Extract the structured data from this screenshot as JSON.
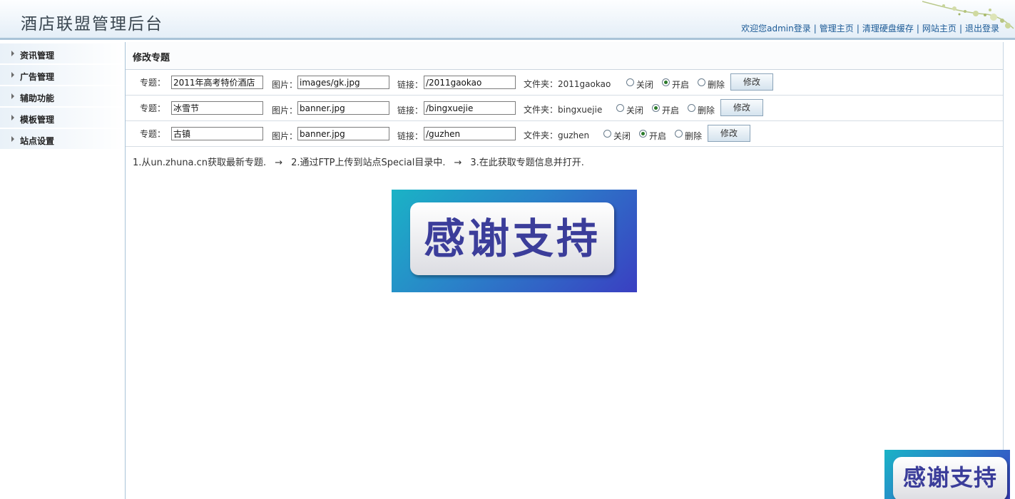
{
  "header": {
    "title": "酒店联盟管理后台",
    "welcome": "欢迎您admin登录",
    "links": [
      "管理主页",
      "清理硬盘缓存",
      "网站主页",
      "退出登录"
    ],
    "separator": "|"
  },
  "sidebar": {
    "items": [
      {
        "label": "资讯管理"
      },
      {
        "label": "广告管理"
      },
      {
        "label": "辅助功能"
      },
      {
        "label": "模板管理"
      },
      {
        "label": "站点设置"
      }
    ]
  },
  "main": {
    "title": "修改专题",
    "labels": {
      "topic": "专题：",
      "image": "图片：",
      "link": "链接：",
      "folder_prefix": "文件夹：",
      "close": "关闭",
      "open": "开启",
      "delete": "删除",
      "modify": "修改"
    },
    "rows": [
      {
        "topic": "2011年高考特价酒店",
        "image": "images/gk.jpg",
        "link": "/2011gaokao",
        "folder": "2011gaokao",
        "status": "open"
      },
      {
        "topic": "冰雪节",
        "image": "banner.jpg",
        "link": "/bingxuejie",
        "folder": "bingxuejie",
        "status": "open"
      },
      {
        "topic": "古镇",
        "image": "banner.jpg",
        "link": "/guzhen",
        "folder": "guzhen",
        "status": "open"
      }
    ],
    "steps": {
      "step1": "1.从un.zhuna.cn获取最新专题.",
      "step2": "2.通过FTP上传到站点Special目录中.",
      "step3": "3.在此获取专题信息并打开.",
      "arrow": "→"
    }
  },
  "banners": {
    "thanks_text": "感谢支持"
  }
}
